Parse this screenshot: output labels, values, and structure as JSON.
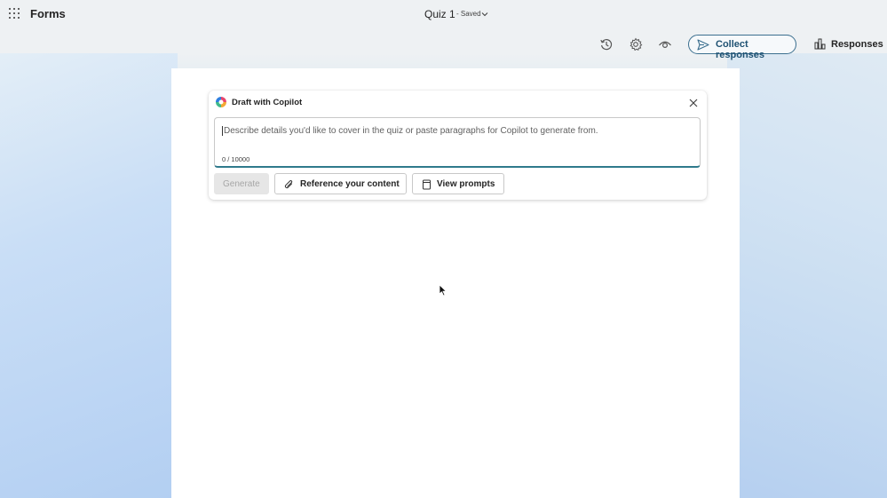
{
  "header": {
    "app_name": "Forms",
    "doc_title": "Quiz 1",
    "save_status": "- Saved"
  },
  "toolbar": {
    "icons": [
      "history-icon",
      "settings-gear-icon",
      "preview-eye-icon"
    ],
    "collect_label": "Collect responses",
    "responses_label": "Responses"
  },
  "copilot": {
    "title": "Draft with Copilot",
    "placeholder": "Describe details you'd like to cover in the quiz or paste paragraphs for Copilot to generate from.",
    "char_count": "0 / 10000",
    "generate_label": "Generate",
    "reference_label": "Reference your content",
    "prompts_label": "View prompts"
  },
  "colors": {
    "accent": "#2f7a8c",
    "collect_border": "#3b6f8f",
    "collect_text": "#1f5273"
  }
}
